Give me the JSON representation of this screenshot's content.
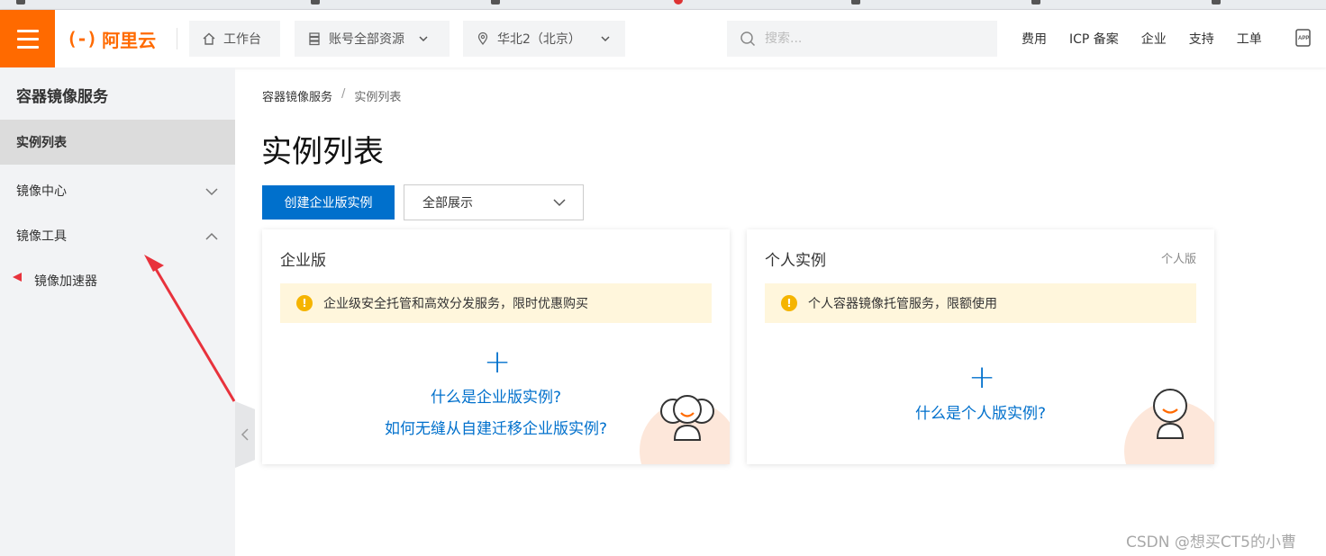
{
  "brand": {
    "logo_text": "阿里云",
    "logo_mark": "(-)"
  },
  "topbar": {
    "workbench": "工作台",
    "account_resources": "账号全部资源",
    "region": "华北2（北京）",
    "search_placeholder": "搜索...",
    "links": [
      "费用",
      "ICP 备案",
      "企业",
      "支持",
      "工单"
    ]
  },
  "sidebar": {
    "title": "容器镜像服务",
    "items": [
      {
        "label": "实例列表",
        "active": true
      },
      {
        "label": "镜像中心"
      },
      {
        "label": "镜像工具"
      }
    ],
    "sub_items": [
      {
        "label": "镜像加速器"
      }
    ]
  },
  "breadcrumb": {
    "root": "容器镜像服务",
    "separator": "/",
    "current": "实例列表"
  },
  "page": {
    "title": "实例列表",
    "create_button": "创建企业版实例",
    "filter_value": "全部展示"
  },
  "cards": {
    "enterprise": {
      "title": "企业版",
      "notice": "企业级安全托管和高效分发服务，限时优惠购买",
      "links": [
        "什么是企业版实例?",
        "如何无缝从自建迁移企业版实例?"
      ]
    },
    "personal": {
      "title": "个人实例",
      "tag": "个人版",
      "notice": "个人容器镜像托管服务，限额使用",
      "links": [
        "什么是个人版实例?"
      ]
    }
  },
  "watermark": "CSDN @想买CT5的小曹",
  "colors": {
    "brand": "#ff6a00",
    "primary": "#0070cc",
    "notice_bg": "#fff6dc",
    "warning": "#f5b400",
    "annotation_arrow": "#e8323c"
  }
}
